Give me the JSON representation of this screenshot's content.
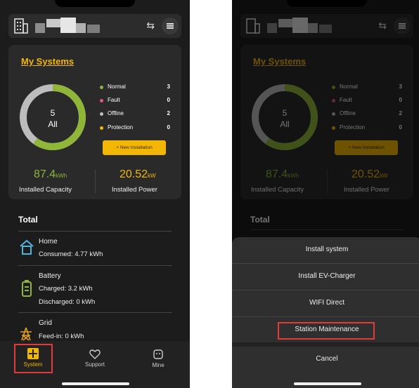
{
  "colors": {
    "accent": "#f2b705",
    "normal": "#8fb539",
    "fault": "#e25a70",
    "offline": "#bdbdbd",
    "protection": "#f2b705",
    "highlight": "#e03a3a"
  },
  "screen1": {
    "my_systems_title": "My Systems",
    "ring": {
      "count": "5",
      "label": "All",
      "fractions": {
        "normal": 0.6,
        "offline": 0.4
      }
    },
    "legend": [
      {
        "label": "Normal",
        "value": "3"
      },
      {
        "label": "Fault",
        "value": "0"
      },
      {
        "label": "Offline",
        "value": "2"
      },
      {
        "label": "Protection",
        "value": "0"
      }
    ],
    "new_installation_button": "+ New Installation",
    "capacity": {
      "value": "87.4",
      "unit": "kWh",
      "label": "Installed Capacity"
    },
    "power": {
      "value": "20.52",
      "unit": "kW",
      "label": "Installed Power"
    },
    "total": {
      "title": "Total",
      "home": {
        "title": "Home",
        "line1": "Consumed: 4.77 kWh"
      },
      "battery": {
        "title": "Battery",
        "line1": "Charged: 3.2 kWh",
        "line2": "Discharged: 0 kWh"
      },
      "grid": {
        "title": "Grid",
        "line1": "Feed-in: 0 kWh"
      }
    },
    "tabs": {
      "system": "System",
      "support": "Support",
      "mine": "Mine"
    }
  },
  "screen2": {
    "sheet_items": {
      "install_system": "Install system",
      "install_ev_charger": "Install EV-Charger",
      "wifi_direct": "WIFI Direct",
      "station_maintenance": "Station Maintenance",
      "cancel": "Cancel"
    }
  }
}
